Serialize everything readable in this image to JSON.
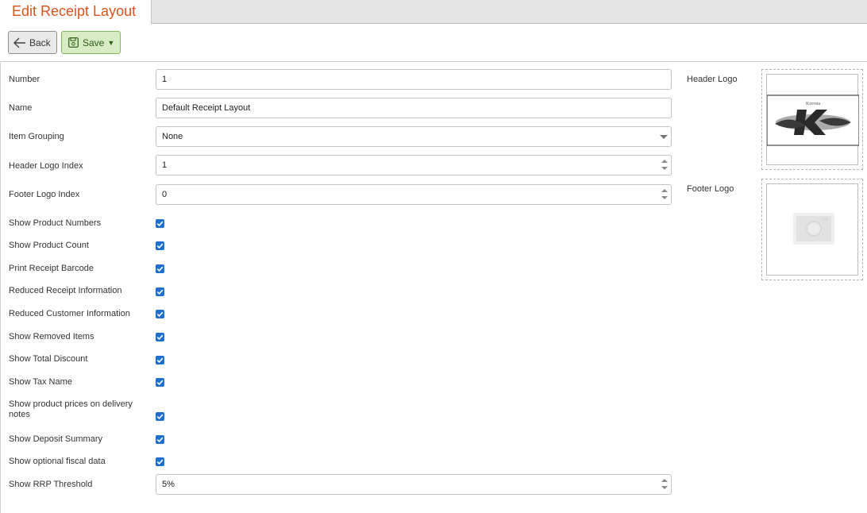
{
  "tab": {
    "title": "Edit Receipt Layout"
  },
  "toolbar": {
    "back_label": "Back",
    "save_label": "Save"
  },
  "form": {
    "number": {
      "label": "Number",
      "value": "1"
    },
    "name": {
      "label": "Name",
      "value": "Default Receipt Layout"
    },
    "item_grouping": {
      "label": "Item Grouping",
      "value": "None"
    },
    "header_logo_index": {
      "label": "Header Logo Index",
      "value": "1"
    },
    "footer_logo_index": {
      "label": "Footer Logo Index",
      "value": "0"
    },
    "checkboxes": [
      {
        "label": "Show Product Numbers",
        "checked": true
      },
      {
        "label": "Show Product Count",
        "checked": true
      },
      {
        "label": "Print Receipt Barcode",
        "checked": true
      },
      {
        "label": "Reduced Receipt Information",
        "checked": true
      },
      {
        "label": "Reduced Customer Information",
        "checked": true
      },
      {
        "label": "Show Removed Items",
        "checked": true
      },
      {
        "label": "Show Total Discount",
        "checked": true
      },
      {
        "label": "Show Tax Name",
        "checked": true
      },
      {
        "label": "Show product prices on delivery notes",
        "checked": true
      },
      {
        "label": "Show Deposit Summary",
        "checked": true
      },
      {
        "label": "Show optional fiscal data",
        "checked": true
      }
    ],
    "rrp_threshold": {
      "label": "Show RRP Threshold",
      "value": "5%"
    }
  },
  "logos": {
    "header_label": "Header Logo",
    "header_logo_text": "Korona",
    "footer_label": "Footer Logo"
  },
  "colors": {
    "accent": "#d9541e",
    "checkbox": "#1f6fd1",
    "save_bg": "#d7ecc2"
  },
  "icons": {
    "back": "arrow-left-icon",
    "save": "floppy-disk-icon",
    "placeholder": "camera-icon"
  }
}
